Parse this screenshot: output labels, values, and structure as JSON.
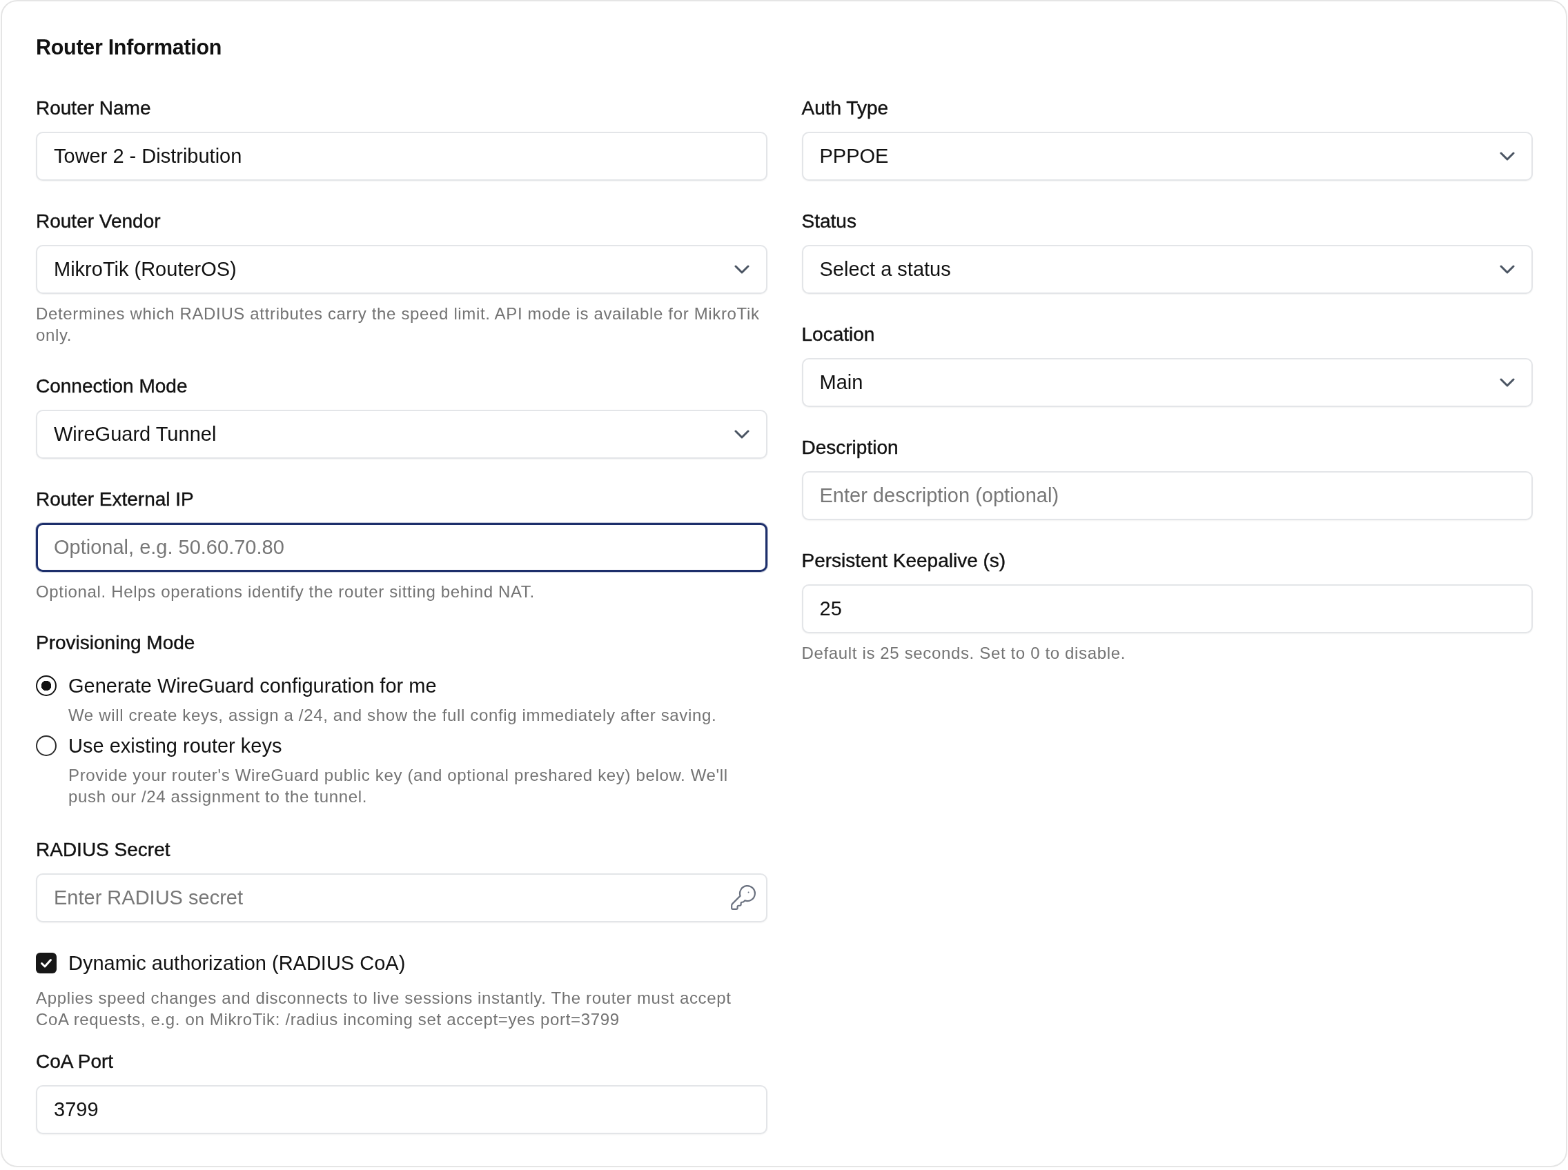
{
  "section_title": "Router Information",
  "left_column": [
    {
      "kind": "text",
      "label": "Router Name",
      "value": "Tower 2 - Distribution",
      "focused": false
    },
    {
      "kind": "select",
      "label": "Router Vendor",
      "value": "MikroTik (RouterOS)",
      "focused": false,
      "help": "Determines which RADIUS attributes carry the speed limit. API mode is available for MikroTik only."
    },
    {
      "kind": "select",
      "label": "Connection Mode",
      "value": "WireGuard Tunnel",
      "focused": false
    },
    {
      "kind": "text",
      "label": "Router External IP",
      "placeholder": "Optional, e.g. 50.60.70.80",
      "focused": true,
      "help": "Optional. Helps operations identify the router sitting behind NAT."
    },
    {
      "kind": "radio_group",
      "label": "Provisioning Mode",
      "options": [
        {
          "label": "Generate WireGuard configuration for me",
          "description": "We will create keys, assign a /24, and show the full config immediately after saving.",
          "selected": true
        },
        {
          "label": "Use existing router keys",
          "description": "Provide your router's WireGuard public key (and optional preshared key) below. We'll push our /24 assignment to the tunnel.",
          "selected": false
        }
      ]
    },
    {
      "kind": "secret",
      "label": "RADIUS Secret",
      "placeholder": "Enter RADIUS secret",
      "focused": false
    },
    {
      "kind": "checkbox",
      "label": "Dynamic authorization (RADIUS CoA)",
      "checked": true,
      "help": "Applies speed changes and disconnects to live sessions instantly. The router must accept CoA requests, e.g. on MikroTik: /radius incoming set accept=yes port=3799"
    },
    {
      "kind": "text",
      "label": "CoA Port",
      "value": "3799",
      "focused": false
    }
  ],
  "right_column": [
    {
      "kind": "select",
      "label": "Auth Type",
      "value": "PPPOE",
      "focused": false
    },
    {
      "kind": "select",
      "label": "Status",
      "value": "Select a status",
      "focused": false
    },
    {
      "kind": "select",
      "label": "Location",
      "value": "Main",
      "focused": false
    },
    {
      "kind": "text",
      "label": "Description",
      "placeholder": "Enter description (optional)",
      "focused": false
    },
    {
      "kind": "text",
      "label": "Persistent Keepalive (s)",
      "value": "25",
      "focused": false,
      "help": "Default is 25 seconds. Set to 0 to disable."
    }
  ]
}
